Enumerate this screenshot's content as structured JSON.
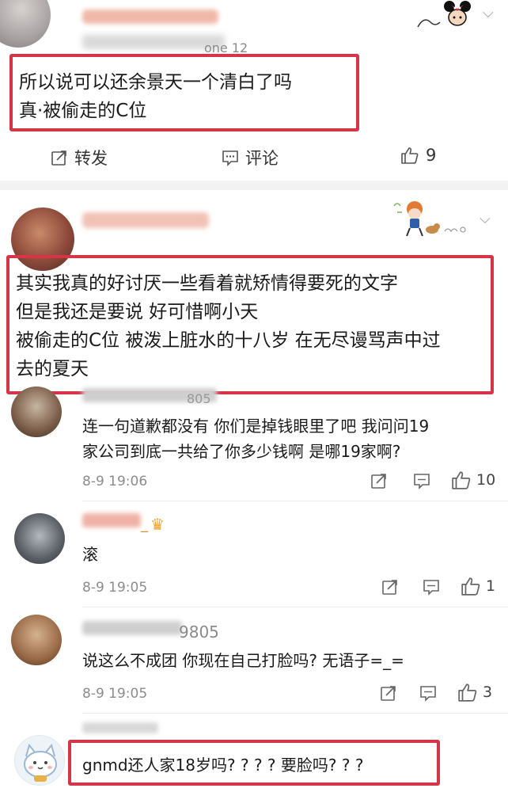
{
  "post1": {
    "source_suffix": "one 12",
    "text_lines": [
      "所以说可以还余景天一个清白了吗",
      "真·被偷走的C位"
    ],
    "actions": {
      "share_label": "转发",
      "comment_label": "评论",
      "like_count": "9"
    }
  },
  "post2": {
    "text_lines": [
      "其实我真的好讨厌一些看着就矫情得要死的文字",
      "但是我还是要说 好可惜啊小天",
      "被偷走的C位 被泼上脏水的十八岁 在无尽谩骂声中过",
      "去的夏天"
    ]
  },
  "comments": [
    {
      "name_suffix": "805",
      "text_lines": [
        "连一句道歉都没有 你们是掉钱眼里了吧 我问问19",
        "家公司到底一共给了你多少钱啊 是哪19家啊?"
      ],
      "time": "8-9 19:06",
      "like_count": "10"
    },
    {
      "name_suffix": "_",
      "text_lines": [
        "滚"
      ],
      "time": "8-9 19:05",
      "like_count": "1"
    },
    {
      "name_suffix": "9805",
      "text_lines": [
        "说这么不成团 你现在自己打脸吗? 无语子=_="
      ],
      "time": "8-9 19:05",
      "like_count": "3"
    },
    {
      "name_suffix": "",
      "text_lines": [
        "gnmd还人家18岁吗? ? ? ? 要脸吗? ? ?"
      ]
    }
  ],
  "icons": {
    "share": "share-icon",
    "comment": "comment-icon",
    "like": "thumbs-up-icon",
    "chevron": "chevron-down-icon",
    "crown": "crown-icon"
  },
  "colors": {
    "highlight_border": "#d63548",
    "divider": "#f2f2f2",
    "secondary_text": "#8c8c8c"
  }
}
